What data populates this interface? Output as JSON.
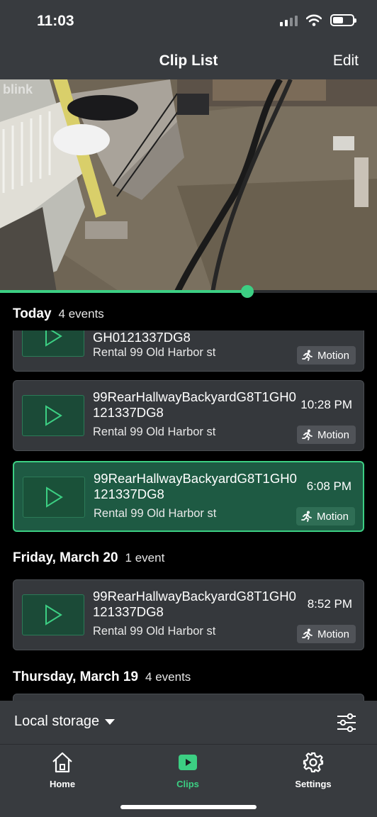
{
  "status_bar": {
    "time": "11:03"
  },
  "header": {
    "title": "Clip List",
    "edit_label": "Edit"
  },
  "video": {
    "watermark": "blink",
    "progress": 0.656
  },
  "colors": {
    "accent": "#3ccf83",
    "card_bg": "#35383c",
    "selected_bg": "#1e5a43"
  },
  "sections": [
    {
      "title": "Today",
      "count": "4 events",
      "clips": [
        {
          "name": "GH0121337DG8",
          "time": "",
          "location": "Rental 99 Old Harbor st",
          "tag": "Motion",
          "selected": false,
          "partial": true
        },
        {
          "name": "99RearHallwayBackyardG8T1GH0121337DG8",
          "time": "10:28 PM",
          "location": "Rental 99 Old Harbor st",
          "tag": "Motion",
          "selected": false
        },
        {
          "name": "99RearHallwayBackyardG8T1GH0121337DG8",
          "time": "6:08 PM",
          "location": "Rental 99 Old Harbor st",
          "tag": "Motion",
          "selected": true
        }
      ]
    },
    {
      "title": "Friday, March 20",
      "count": "1 event",
      "clips": [
        {
          "name": "99RearHallwayBackyardG8T1GH0121337DG8",
          "time": "8:52 PM",
          "location": "Rental 99 Old Harbor st",
          "tag": "Motion",
          "selected": false
        }
      ]
    },
    {
      "title": "Thursday, March 19",
      "count": "4 events",
      "clips": []
    }
  ],
  "storage": {
    "label": "Local storage"
  },
  "tabs": [
    {
      "label": "Home",
      "icon": "home-icon",
      "active": false
    },
    {
      "label": "Clips",
      "icon": "clips-play-icon",
      "active": true
    },
    {
      "label": "Settings",
      "icon": "gear-icon",
      "active": false
    }
  ]
}
